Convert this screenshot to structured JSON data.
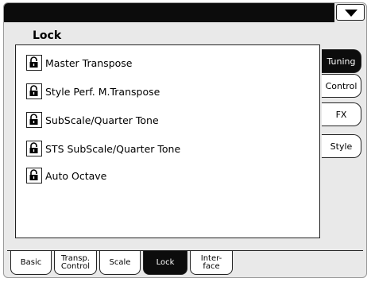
{
  "page": {
    "title": "Lock"
  },
  "lock_items": [
    {
      "label": "Master Transpose",
      "icon": "lock-icon"
    },
    {
      "label": "Style Perf. M.Transpose",
      "icon": "lock-icon"
    },
    {
      "label": "SubScale/Quarter Tone",
      "icon": "lock-icon"
    },
    {
      "label": "STS SubScale/Quarter Tone",
      "icon": "lock-icon"
    },
    {
      "label": "Auto Octave",
      "icon": "lock-icon"
    }
  ],
  "side_tabs": [
    {
      "label": "Tuning",
      "active": true
    },
    {
      "label": "Control",
      "active": false
    },
    {
      "label": "FX",
      "active": false
    },
    {
      "label": "Style",
      "active": false
    }
  ],
  "bottom_tabs": [
    {
      "label": "Basic",
      "active": false
    },
    {
      "label": "Transp.\nControl",
      "active": false
    },
    {
      "label": "Scale",
      "active": false
    },
    {
      "label": "Lock",
      "active": true
    },
    {
      "label": "Inter-\nface",
      "active": false
    }
  ],
  "colors": {
    "dark": "#0c0c0c",
    "panel_bg": "#e9e9e9",
    "white": "#ffffff"
  }
}
